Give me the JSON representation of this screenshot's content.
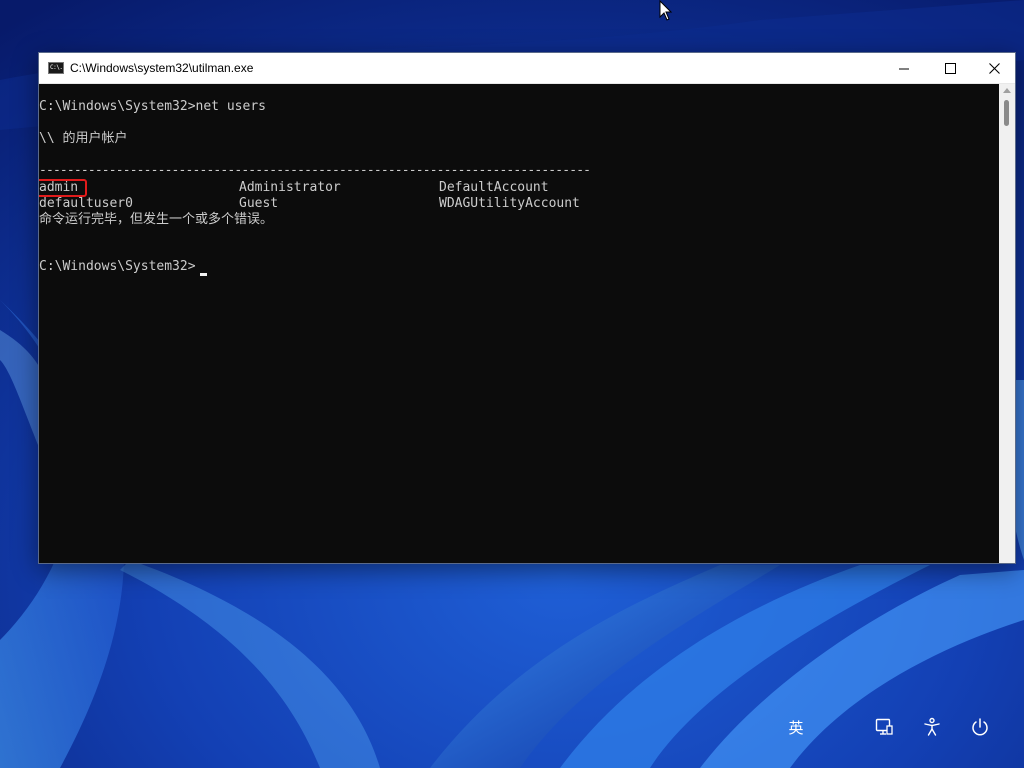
{
  "window": {
    "title": "C:\\Windows\\system32\\utilman.exe",
    "icon_label": "C:\\.",
    "controls": [
      "minimize-icon",
      "maximize-icon",
      "close-icon"
    ]
  },
  "console": {
    "prompt1": "C:\\Windows\\System32>net users",
    "header": "\\\\ 的用户帐户",
    "separator": "-------------------------------------------------------------------------------",
    "users": [
      [
        "admin",
        "Administrator",
        "DefaultAccount"
      ],
      [
        "defaultuser0",
        "Guest",
        "WDAGUtilityAccount"
      ]
    ],
    "status": "命令运行完毕，但发生一个或多个错误。",
    "prompt2": "C:\\Windows\\System32>",
    "highlighted_user": "admin"
  },
  "lock_screen": {
    "language": "英",
    "icons": [
      "network-icon",
      "accessibility-icon",
      "power-icon"
    ]
  },
  "colors": {
    "console_bg": "#0c0c0c",
    "console_text": "#cccccc",
    "highlight": "#e01b1b"
  }
}
